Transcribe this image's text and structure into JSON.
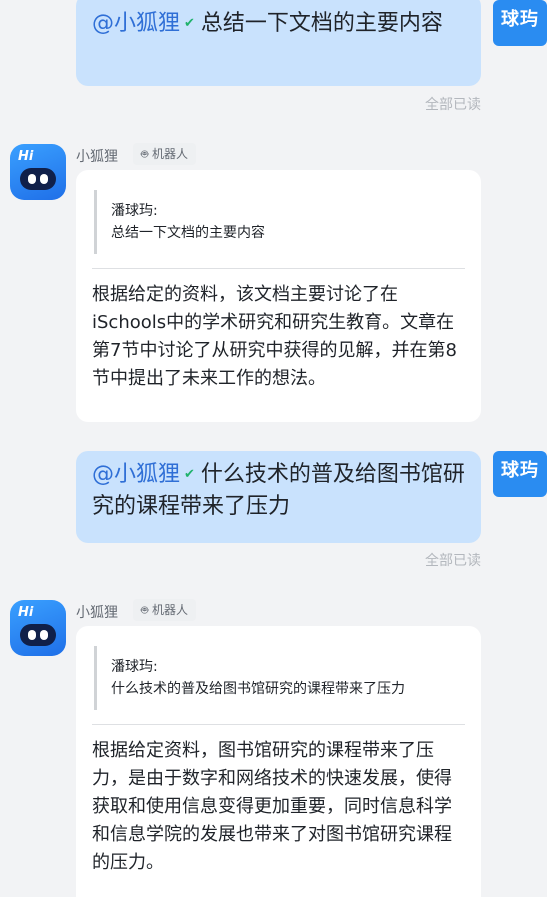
{
  "messages": [
    {
      "mention": "@小狐狸",
      "text": "总结一下文档的主要内容",
      "read_status": "全部已读",
      "sender": "球玙",
      "reply": {
        "bot_name": "小狐狸",
        "bot_tag": "机器人",
        "quote_author": "潘球玙:",
        "quote_text": "总结一下文档的主要内容",
        "answer": "根据给定的资料，该文档主要讨论了在iSchools中的学术研究和研究生教育。文章在第7节中讨论了从研究中获得的见解，并在第8节中提出了未来工作的想法。"
      }
    },
    {
      "mention": "@小狐狸",
      "text": "什么技术的普及给图书馆研究的课程带来了压力",
      "read_status": "全部已读",
      "sender": "球玙",
      "reply": {
        "bot_name": "小狐狸",
        "bot_tag": "机器人",
        "quote_author": "潘球玙:",
        "quote_text": "什么技术的普及给图书馆研究的课程带来了压力",
        "answer": "根据给定资料，图书馆研究的课程带来了压力，是由于数字和网络技术的快速发展，使得获取和使用信息变得更加重要，同时信息科学和信息学院的发展也带来了对图书馆研究课程的压力。"
      }
    }
  ],
  "bot_avatar_text": "Hi",
  "colors": {
    "user_bubble": "#c9e2fd",
    "mention": "#2f6fd6",
    "user_avatar": "#2a8cf1",
    "verified": "#20b26b"
  }
}
